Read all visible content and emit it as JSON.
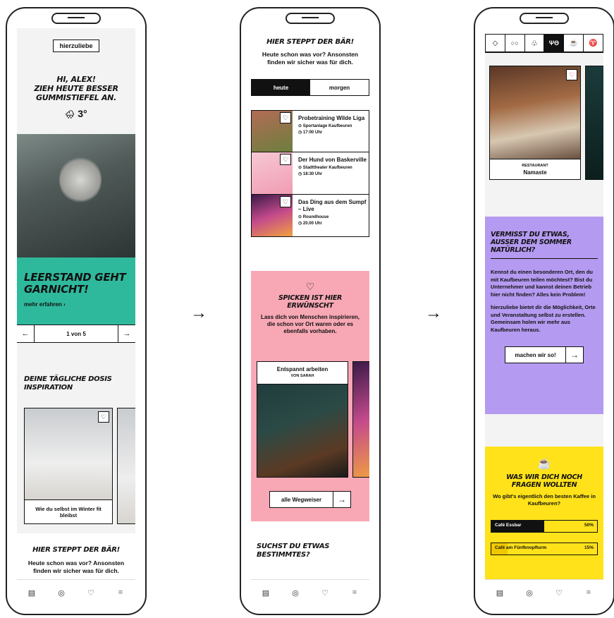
{
  "arrows": [
    "→",
    "→"
  ],
  "tabbar": [
    "▤",
    "◎",
    "♡",
    "="
  ],
  "screen1": {
    "logo": "hierzuliebe",
    "greeting": [
      "HI, ALEX!",
      "ZIEH HEUTE BESSER",
      "GUMMISTIEFEL AN."
    ],
    "weather_icon": "🌧",
    "temperature": "3°",
    "hero_title": "LEERSTAND GEHT GARNICHT!",
    "hero_link": "mehr erfahren  ›",
    "pager": {
      "prev": "←",
      "label": "1 von 5",
      "next": "→"
    },
    "inspiration_title": "DEINE TÄGLICHE DOSIS INSPIRATION",
    "card_caption": "Wie du selbst im Winter fit bleibst",
    "footer_title": "HIER STEPPT DER BÄR!",
    "footer_text": "Heute schon was vor? Ansonsten finden wir sicher was für dich."
  },
  "screen2": {
    "title": "HIER STEPPT DER BÄR!",
    "subtitle": "Heute schon was vor? Ansonsten finden wir sicher was für dich.",
    "tabs": [
      "heute",
      "morgen"
    ],
    "events": [
      {
        "title": "Probetraining Wilde Liga",
        "place": "⊙ Sportanlage Kaufbeuren",
        "time": "◷ 17:00 Uhr"
      },
      {
        "title": "Der Hund von Baskerville",
        "place": "⊙ Stadttheater Kaufbeuren",
        "time": "◷ 18:30 Uhr"
      },
      {
        "title": "Das Ding aus dem Sumpf – Live",
        "place": "⊙ Roundhouse",
        "time": "◷ 20.00 Uhr"
      }
    ],
    "heart_icon": "♡",
    "spicken_title": "SPICKEN IST HIER ERWÜNSCHT",
    "spicken_text": "Lass dich von Menschen inspirieren, die schon vor Ort waren oder es ebenfalls vorhaben.",
    "card_title": "Entspannt arbeiten",
    "card_author": "VON SARAH",
    "button_label": "alle Wegweiser",
    "button_arrow": "→",
    "bottom_title": "SUCHST DU ETWAS BESTIMMTES?"
  },
  "screen3": {
    "categories": [
      "◇",
      "○○",
      "♧",
      "ΨΘ",
      "☕",
      "♈"
    ],
    "place_type": "RESTAURANT",
    "place_name": "Namaste",
    "missing_title": "VERMISST DU ETWAS, AUSSER DEM SOMMER NATÜRLICH?",
    "missing_text1": "Kennst du einen besonderen Ort, den du mit Kaufbeuren teilen möchtest? Bist du Unternehmer und kannst deinen Betrieb hier nicht finden? Alles kein Problem!",
    "missing_text2": "hierzuliebe bietet dir die Möglichkeit, Orte und Veranstaltung selbst zu erstellen. Gemeinsam holen wir mehr aus Kaufbeuren heraus.",
    "button_label": "machen wir so!",
    "button_arrow": "→",
    "coffee_icon": "☕",
    "question_title": "WAS WIR DICH NOCH FRAGEN WOLLTEN",
    "question_text": "Wo gibt's eigentlich den besten Kaffee in Kaufbeuren?",
    "poll": [
      {
        "label": "Café Essbar",
        "percent_label": "50%",
        "value": 50
      },
      {
        "label": "Café am Fünfknopfturm",
        "percent_label": "15%",
        "value": 15
      }
    ]
  }
}
